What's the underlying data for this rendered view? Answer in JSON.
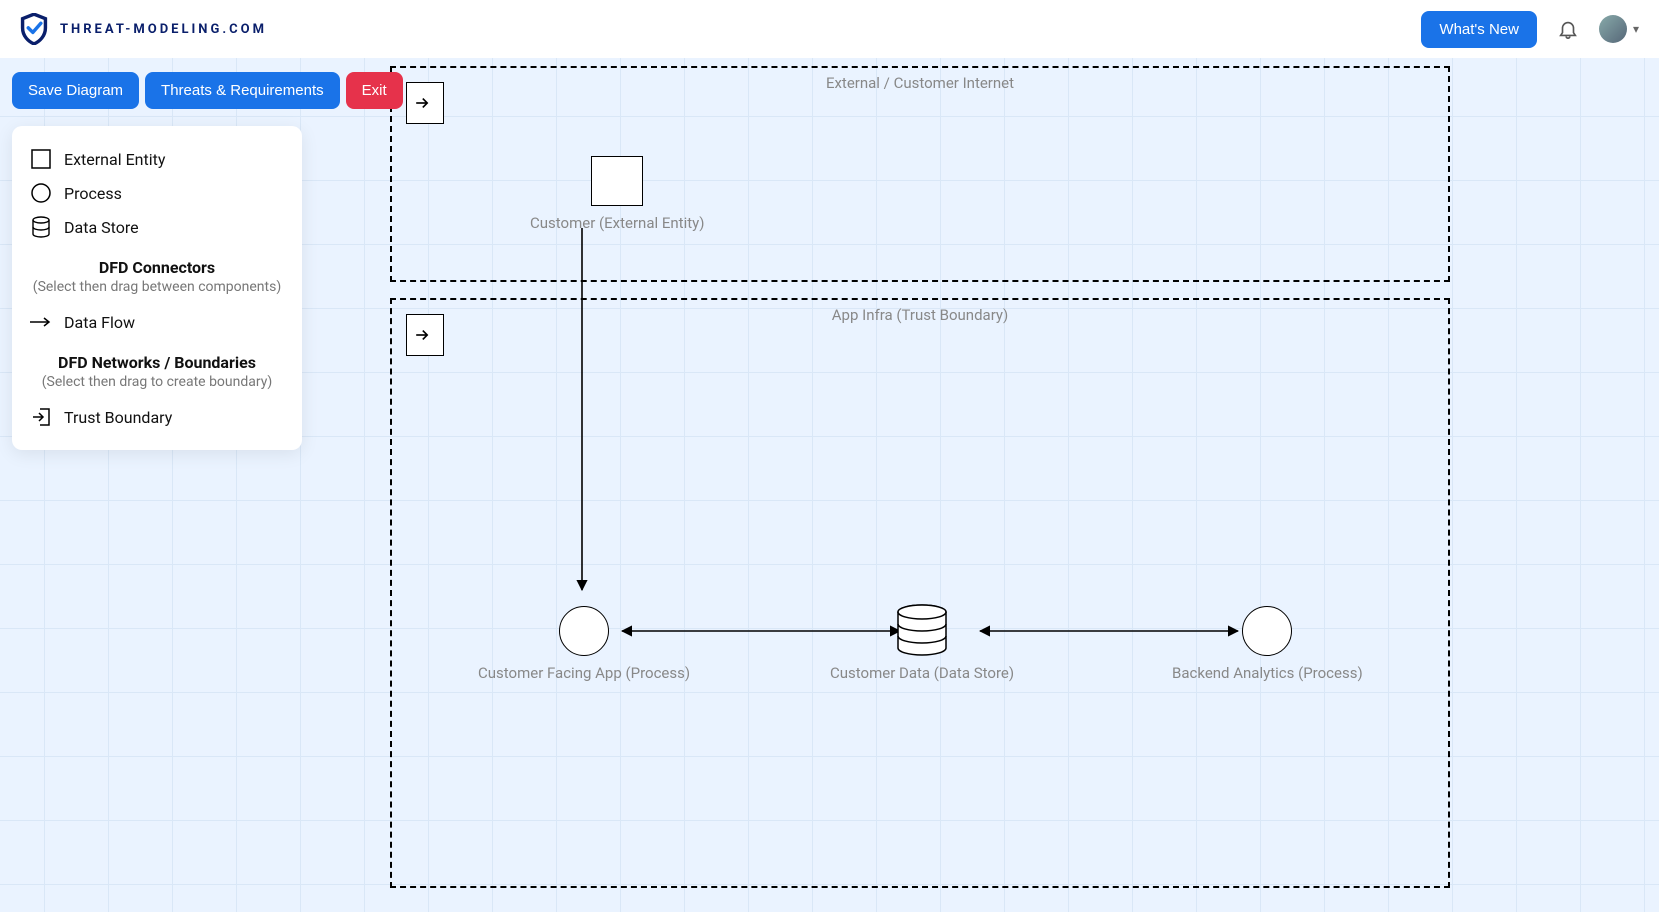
{
  "brand": "THREAT-MODELING.COM",
  "header": {
    "whats_new": "What's New"
  },
  "toolbar": {
    "save": "Save Diagram",
    "threats": "Threats & Requirements",
    "exit": "Exit"
  },
  "palette": {
    "items": {
      "external_entity": "External Entity",
      "process": "Process",
      "data_store": "Data Store",
      "data_flow": "Data Flow",
      "trust_boundary": "Trust Boundary"
    },
    "connectors_heading": "DFD Connectors",
    "connectors_sub": "(Select then drag between components)",
    "boundaries_heading": "DFD Networks / Boundaries",
    "boundaries_sub": "(Select then drag to create boundary)"
  },
  "diagram": {
    "boundaries": [
      {
        "id": "b1",
        "label": "External / Customer Internet"
      },
      {
        "id": "b2",
        "label": "App Infra (Trust Boundary)"
      }
    ],
    "nodes": {
      "customer": "Customer (External Entity)",
      "app": "Customer Facing App (Process)",
      "data": "Customer Data (Data Store)",
      "analytics": "Backend Analytics (Process)"
    },
    "flows": [
      {
        "from": "customer",
        "to": "app",
        "bidirectional": false
      },
      {
        "from": "app",
        "to": "data",
        "bidirectional": true
      },
      {
        "from": "data",
        "to": "analytics",
        "bidirectional": true
      }
    ]
  }
}
